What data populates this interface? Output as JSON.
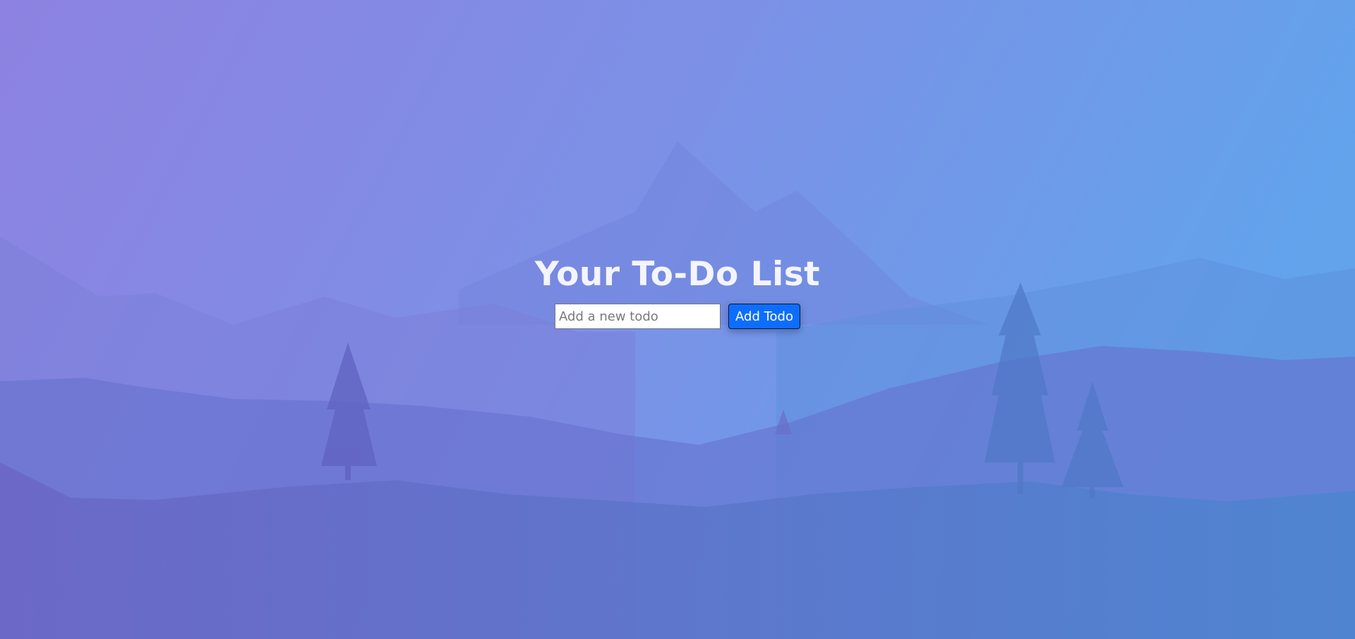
{
  "page": {
    "title": "Your To-Do List"
  },
  "todo_form": {
    "input_value": "",
    "input_placeholder": "Add a new todo",
    "add_button_label": "Add Todo"
  },
  "background": {
    "gradient_left": "#8f84e2",
    "gradient_right": "#63a1eb",
    "accent_button": "#0d6efd"
  }
}
